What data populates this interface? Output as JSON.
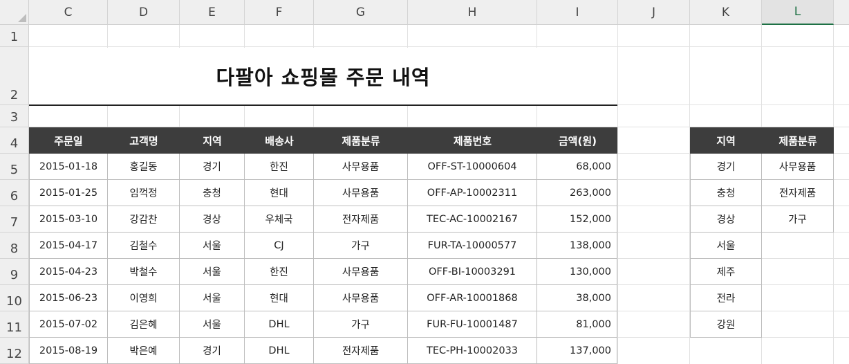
{
  "columns": [
    "C",
    "D",
    "E",
    "F",
    "G",
    "H",
    "I",
    "J",
    "K",
    "L"
  ],
  "selected_column": "L",
  "rows": [
    "1",
    "2",
    "3",
    "4",
    "5",
    "6",
    "7",
    "8",
    "9",
    "10",
    "11",
    "12"
  ],
  "title": "다팔아 쇼핑몰 주문 내역",
  "main_table": {
    "headers": [
      "주문일",
      "고객명",
      "지역",
      "배송사",
      "제품분류",
      "제품번호",
      "금액(원)"
    ],
    "rows": [
      [
        "2015-01-18",
        "홍길동",
        "경기",
        "한진",
        "사무용품",
        "OFF-ST-10000604",
        "68,000"
      ],
      [
        "2015-01-25",
        "임꺽정",
        "충청",
        "현대",
        "사무용품",
        "OFF-AP-10002311",
        "263,000"
      ],
      [
        "2015-03-10",
        "강감찬",
        "경상",
        "우체국",
        "전자제품",
        "TEC-AC-10002167",
        "152,000"
      ],
      [
        "2015-04-17",
        "김철수",
        "서울",
        "CJ",
        "가구",
        "FUR-TA-10000577",
        "138,000"
      ],
      [
        "2015-04-23",
        "박철수",
        "서울",
        "한진",
        "사무용품",
        "OFF-BI-10003291",
        "130,000"
      ],
      [
        "2015-06-23",
        "이영희",
        "서울",
        "현대",
        "사무용품",
        "OFF-AR-10001868",
        "38,000"
      ],
      [
        "2015-07-02",
        "김은혜",
        "서울",
        "DHL",
        "가구",
        "FUR-FU-10001487",
        "81,000"
      ],
      [
        "2015-08-19",
        "박은예",
        "경기",
        "DHL",
        "전자제품",
        "TEC-PH-10002033",
        "137,000"
      ]
    ]
  },
  "side_table": {
    "headers": [
      "지역",
      "제품분류"
    ],
    "region": [
      "경기",
      "충청",
      "경상",
      "서울",
      "제주",
      "전라",
      "강원"
    ],
    "category": [
      "사무용품",
      "전자제품",
      "가구"
    ]
  }
}
